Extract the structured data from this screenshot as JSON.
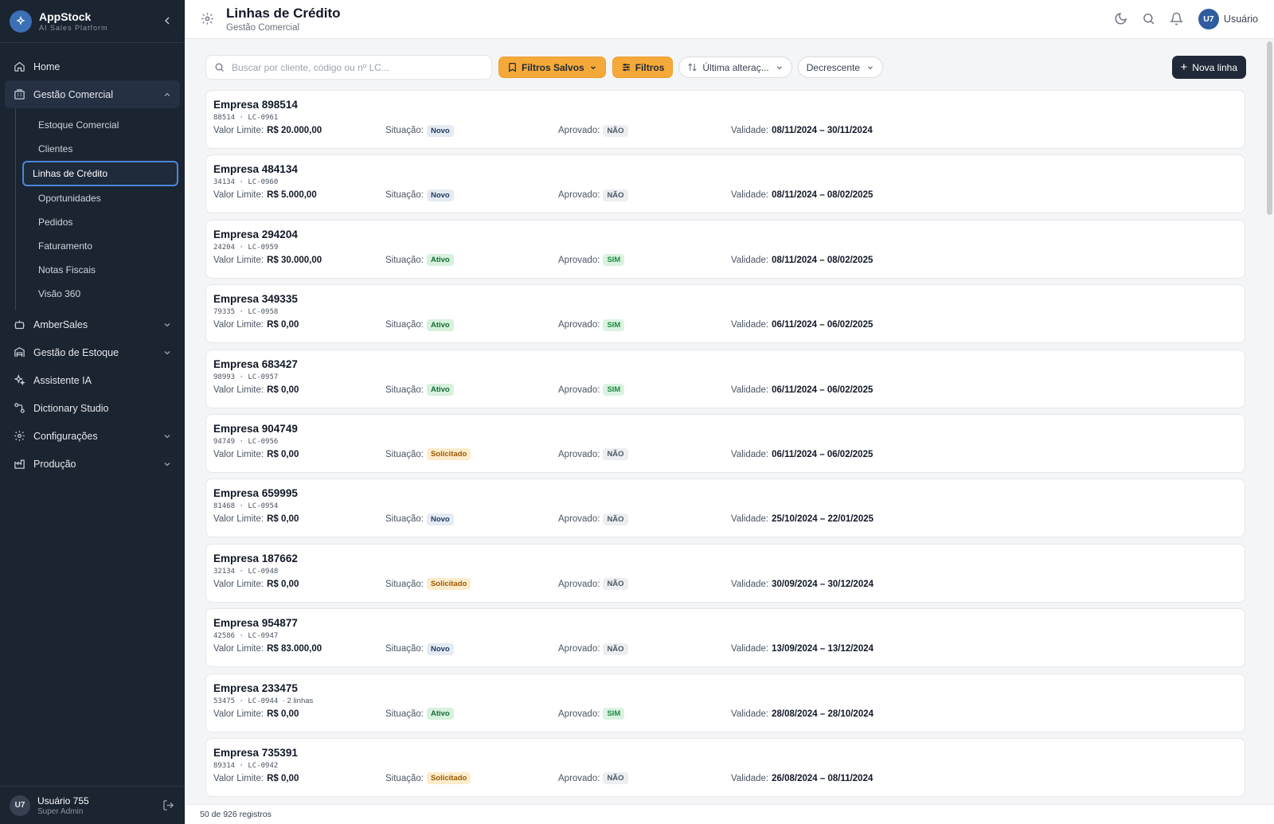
{
  "app": {
    "name": "AppStock",
    "tagline": "AI Sales Platform"
  },
  "sidebar": {
    "items": [
      {
        "label": "Home",
        "icon": "home-icon"
      },
      {
        "label": "Gestão Comercial",
        "icon": "building-icon",
        "children": [
          "Estoque Comercial",
          "Clientes",
          "Linhas de Crédito",
          "Oportunidades",
          "Pedidos",
          "Faturamento",
          "Notas Fiscais",
          "Visão 360"
        ],
        "active_child": "Linhas de Crédito"
      },
      {
        "label": "AmberSales",
        "icon": "bot-icon"
      },
      {
        "label": "Gestão de Estoque",
        "icon": "warehouse-icon"
      },
      {
        "label": "Assistente IA",
        "icon": "sparkles-icon"
      },
      {
        "label": "Dictionary Studio",
        "icon": "workflow-icon"
      },
      {
        "label": "Configurações",
        "icon": "gear-icon"
      },
      {
        "label": "Produção",
        "icon": "factory-icon"
      }
    ],
    "user": {
      "initials": "U7",
      "name": "Usuário 755",
      "role": "Super Admin"
    }
  },
  "header": {
    "title": "Linhas de Crédito",
    "subtitle": "Gestão Comercial",
    "user_initials": "U7",
    "user_name": "Usuário"
  },
  "toolbar": {
    "search_placeholder": "Buscar por cliente, código ou nº LC...",
    "saved_filters_label": "Filtros Salvos",
    "filters_label": "Filtros",
    "sort_field": "Última alteraç...",
    "sort_order": "Decrescente",
    "new_label": "Nova linha"
  },
  "labels": {
    "valor": "Valor Limite:",
    "situacao": "Situação:",
    "aprovado": "Aprovado:",
    "validade": "Validade:"
  },
  "records": [
    {
      "name": "Empresa 898514",
      "code": "88514",
      "lc": "LC-0961",
      "extra": "",
      "valor": "R$ 20.000,00",
      "situacao": "Novo",
      "aprovado": "NÃO",
      "validade": "08/11/2024 – 30/11/2024"
    },
    {
      "name": "Empresa 484134",
      "code": "34134",
      "lc": "LC-0960",
      "extra": "",
      "valor": "R$ 5.000,00",
      "situacao": "Novo",
      "aprovado": "NÃO",
      "validade": "08/11/2024 – 08/02/2025"
    },
    {
      "name": "Empresa 294204",
      "code": "24204",
      "lc": "LC-0959",
      "extra": "",
      "valor": "R$ 30.000,00",
      "situacao": "Ativo",
      "aprovado": "SIM",
      "validade": "08/11/2024 – 08/02/2025"
    },
    {
      "name": "Empresa 349335",
      "code": "79335",
      "lc": "LC-0958",
      "extra": "",
      "valor": "R$ 0,00",
      "situacao": "Ativo",
      "aprovado": "SIM",
      "validade": "06/11/2024 – 06/02/2025"
    },
    {
      "name": "Empresa 683427",
      "code": "98993",
      "lc": "LC-0957",
      "extra": "",
      "valor": "R$ 0,00",
      "situacao": "Ativo",
      "aprovado": "SIM",
      "validade": "06/11/2024 – 06/02/2025"
    },
    {
      "name": "Empresa 904749",
      "code": "94749",
      "lc": "LC-0956",
      "extra": "",
      "valor": "R$ 0,00",
      "situacao": "Solicitado",
      "aprovado": "NÃO",
      "validade": "06/11/2024 – 06/02/2025"
    },
    {
      "name": "Empresa 659995",
      "code": "81468",
      "lc": "LC-0954",
      "extra": "",
      "valor": "R$ 0,00",
      "situacao": "Novo",
      "aprovado": "NÃO",
      "validade": "25/10/2024 – 22/01/2025"
    },
    {
      "name": "Empresa 187662",
      "code": "32134",
      "lc": "LC-0948",
      "extra": "",
      "valor": "R$ 0,00",
      "situacao": "Solicitado",
      "aprovado": "NÃO",
      "validade": "30/09/2024 – 30/12/2024"
    },
    {
      "name": "Empresa 954877",
      "code": "42586",
      "lc": "LC-0947",
      "extra": "",
      "valor": "R$ 83.000,00",
      "situacao": "Novo",
      "aprovado": "NÃO",
      "validade": "13/09/2024 – 13/12/2024"
    },
    {
      "name": "Empresa 233475",
      "code": "53475",
      "lc": "LC-0944",
      "extra": "· 2 linhas",
      "valor": "R$ 0,00",
      "situacao": "Ativo",
      "aprovado": "SIM",
      "validade": "28/08/2024 – 28/10/2024"
    },
    {
      "name": "Empresa 735391",
      "code": "89314",
      "lc": "LC-0942",
      "extra": "",
      "valor": "R$ 0,00",
      "situacao": "Solicitado",
      "aprovado": "NÃO",
      "validade": "26/08/2024 – 08/11/2024"
    }
  ],
  "footer": {
    "count_text": "50 de 926 registros"
  },
  "colors": {
    "sidebar_bg": "#1b2431",
    "accent_orange": "#f5a938",
    "primary_dark": "#1f2937",
    "active_outline": "#4f86d8"
  }
}
